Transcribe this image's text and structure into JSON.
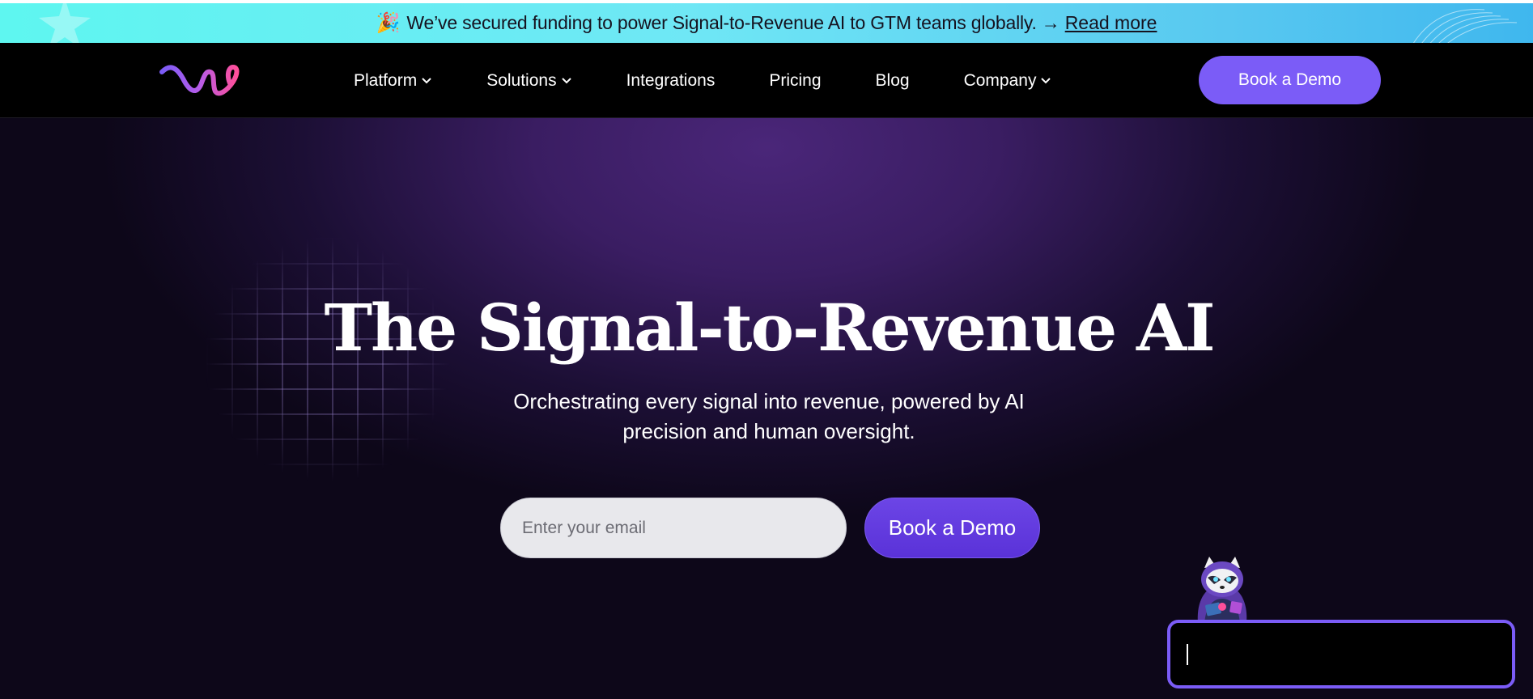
{
  "announcement": {
    "emoji": "🎉",
    "message": "We’ve secured funding to power Signal-to-Revenue AI to GTM teams globally.",
    "arrow": "→",
    "link_label": "Read more"
  },
  "nav": {
    "items": [
      {
        "label": "Platform",
        "has_dropdown": true
      },
      {
        "label": "Solutions",
        "has_dropdown": true
      },
      {
        "label": "Integrations",
        "has_dropdown": false
      },
      {
        "label": "Pricing",
        "has_dropdown": false
      },
      {
        "label": "Blog",
        "has_dropdown": false
      },
      {
        "label": "Company",
        "has_dropdown": true
      }
    ],
    "cta_label": "Book a Demo"
  },
  "hero": {
    "title": "The Signal-to-Revenue AI",
    "subtitle_line1": "Orchestrating every signal into revenue, powered by AI",
    "subtitle_line2": "precision and human oversight.",
    "email_placeholder": "Enter your email",
    "cta_label": "Book a Demo"
  },
  "colors": {
    "accent": "#7b5cf7",
    "announce_bg": "#5ef6f0",
    "hero_bg": "#3a1d62"
  }
}
